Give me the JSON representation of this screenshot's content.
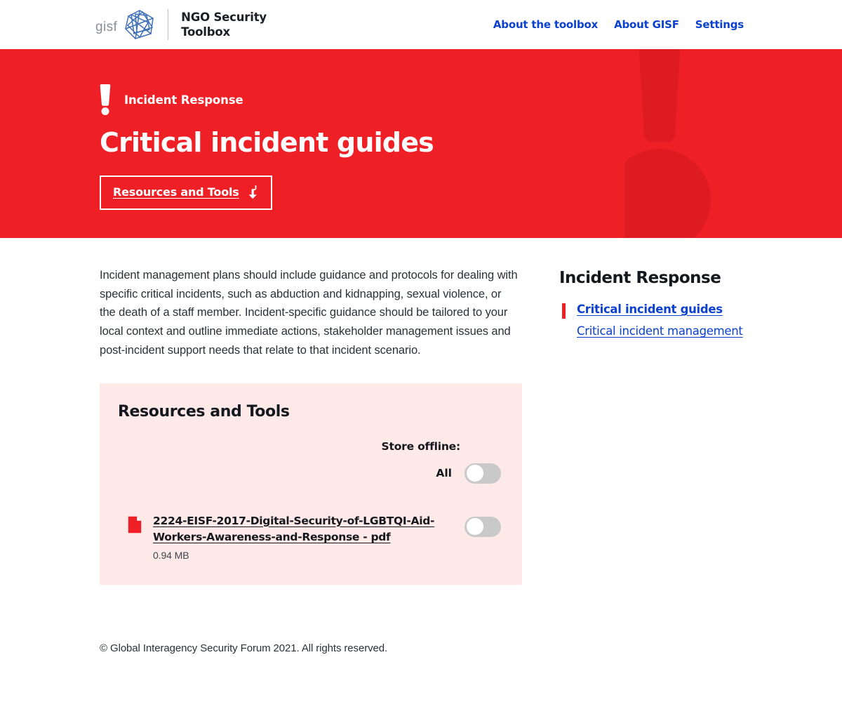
{
  "colors": {
    "hero_red": "#ee2026",
    "panel_pink": "#fde9e8",
    "link_blue": "#0b41cd",
    "toggle_off_track": "#c9c9c9",
    "text_dark": "#15181e"
  },
  "header": {
    "logo_word": "gisf",
    "logo_icon": "gisf-network-mark",
    "title_line1": "NGO Security",
    "title_line2": "Toolbox",
    "nav": [
      {
        "label": "About the toolbox"
      },
      {
        "label": "About GISF"
      },
      {
        "label": "Settings"
      }
    ]
  },
  "hero": {
    "eyebrow_icon": "exclamation-mark-icon",
    "eyebrow": "Incident Response",
    "title": "Critical incident guides",
    "cta_label": "Resources and Tools",
    "cta_icon": "download-arrow-icon",
    "watermark_icon": "exclamation-mark-watermark"
  },
  "main": {
    "intro": "Incident management plans should include guidance and protocols for dealing with specific critical incidents, such as abduction and kidnapping, sexual violence, or the death of a staff member. Incident-specific guidance should be tailored to your local context and outline immediate actions, stakeholder management issues and post-incident support needs that relate to that incident scenario.",
    "resources": {
      "title": "Resources and Tools",
      "store_offline_label": "Store offline:",
      "all_label": "All",
      "all_toggle_state": "off",
      "files": [
        {
          "icon": "pdf-file-icon",
          "name": "2224-EISF-2017-Digital-Security-of-LGBTQI-Aid-Workers-Awareness-and-Response - pdf",
          "size": "0.94 MB",
          "toggle_state": "off"
        }
      ]
    }
  },
  "sidebar": {
    "title": "Incident Response",
    "items": [
      {
        "label": "Critical incident guides",
        "active": true
      },
      {
        "label": "Critical incident management",
        "active": false
      }
    ]
  },
  "footer": {
    "copyright": "© Global Interagency Security Forum 2021. All rights reserved."
  }
}
